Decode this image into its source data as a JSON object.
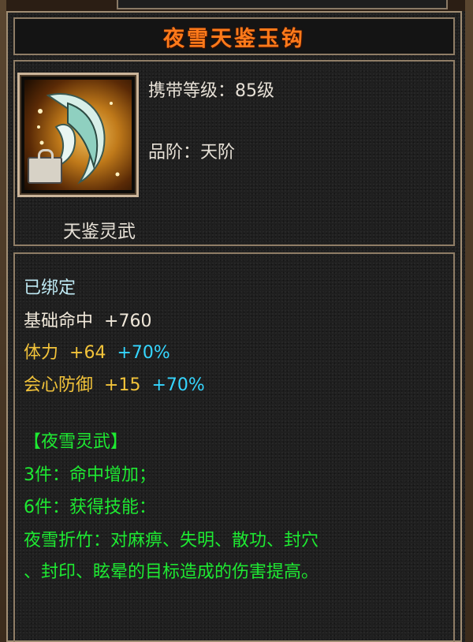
{
  "item": {
    "name": "夜雪天鉴玉钩",
    "carry_level_label": "携带等级：",
    "carry_level_value": "85级",
    "grade_label": "品阶：",
    "grade_value": "天阶",
    "type": "天鉴灵武",
    "bound": "已绑定"
  },
  "stats": [
    {
      "label": "基础命中",
      "value": "+760",
      "bonus": ""
    },
    {
      "label": "体力",
      "value": "+64",
      "bonus": "+70%"
    },
    {
      "label": "会心防御",
      "value": "+15",
      "bonus": "+70%"
    }
  ],
  "set": {
    "name": "【夜雪灵武】",
    "piece3": "3件：命中增加；",
    "piece6": "6件：获得技能：",
    "skill_line1": "夜雪折竹：对麻痹、失明、散功、封穴",
    "skill_line2": "、封印、眩晕的目标造成的伤害提高。"
  },
  "icons": {
    "item_icon": "jade-hook-weapon-icon",
    "bind_badge": "lock-icon"
  },
  "colors": {
    "title": "#ff7a1a",
    "stat_base": "#f0e8da",
    "stat_attr": "#f2c33a",
    "bonus": "#35d6ff",
    "set_text": "#1eea32",
    "bound": "#bfeaf4"
  }
}
